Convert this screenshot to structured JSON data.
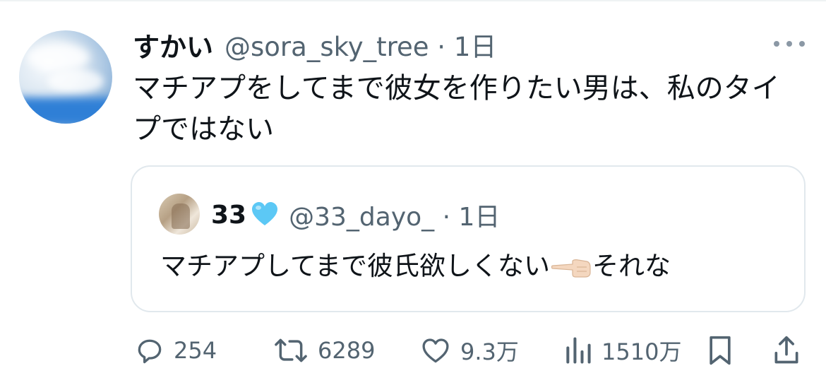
{
  "tweet": {
    "author": {
      "display_name": "すかい",
      "handle_time": "@sora_sky_tree · 1日"
    },
    "text": "マチアプをしてまで彼女を作りたい男は、私のタイプではない"
  },
  "quoted_tweet": {
    "display_name": "33",
    "name_emoji": "light-blue-heart",
    "handle_time": "@33_dayo_ · 1日",
    "text_before_emoji": "マチアプしてまで彼氏欲しくない",
    "emoji": "backhand-index-pointing-left",
    "text_after_emoji": "それな"
  },
  "actions": {
    "replies": "254",
    "retweets": "6289",
    "likes": "9.3万",
    "views": "1510万"
  },
  "colors": {
    "text_primary": "#0f1419",
    "text_secondary": "#536471",
    "border": "#e1e8ed",
    "heart_blue": "#5cc8f5"
  },
  "icons": {
    "more": "more-horizontal-icon",
    "reply": "reply-icon",
    "retweet": "retweet-icon",
    "like": "like-icon",
    "views": "views-icon",
    "bookmark": "bookmark-icon",
    "share": "share-icon"
  }
}
